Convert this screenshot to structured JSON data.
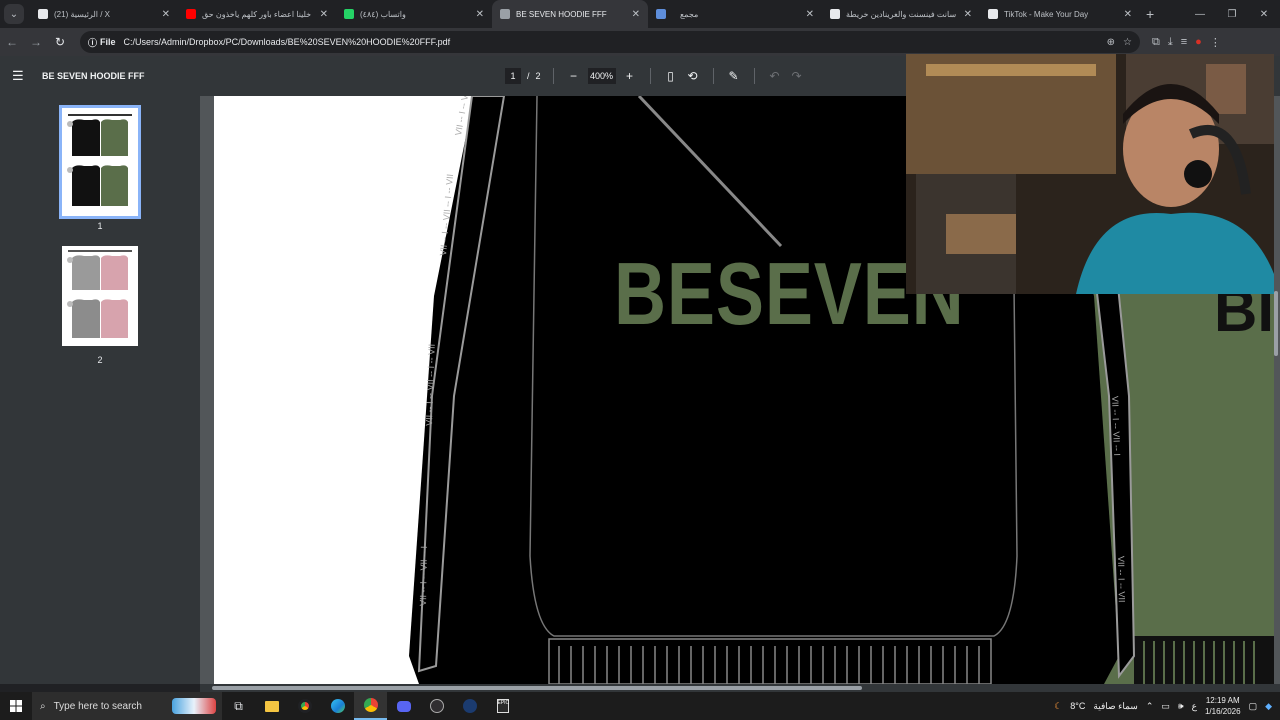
{
  "browser": {
    "tabs": [
      {
        "title": "(21) الرئيسية / X",
        "icon": "x-logo-icon",
        "color": "#e8eaed",
        "active": false,
        "width": 148
      },
      {
        "title": "خلينا اعضاء باور كلهم ياخذون حق",
        "icon": "youtube-icon",
        "color": "#ff0000",
        "active": false,
        "width": 158
      },
      {
        "title": "(٤٨٤) واتساب",
        "icon": "whatsapp-icon",
        "color": "#25d366",
        "active": false,
        "width": 156
      },
      {
        "title": "BE SEVEN HOODIE FFF",
        "icon": "globe-icon",
        "color": "#9aa0a6",
        "active": true,
        "width": 156
      },
      {
        "title": "",
        "icon": "shopify-icon",
        "color": "#5e8edb",
        "active": false,
        "width": 24
      },
      {
        "title": "مجمع",
        "icon": "",
        "color": "#9aa0a6",
        "active": false,
        "width": 150
      },
      {
        "title": "سانت فينسنت والغرينادين خريطة",
        "icon": "google-icon",
        "color": "#e8eaed",
        "active": false,
        "width": 158
      },
      {
        "title": "TikTok - Make Your Day",
        "icon": "tiktok-icon",
        "color": "#e8eaed",
        "active": false,
        "width": 160
      }
    ],
    "omnibox": {
      "scheme_label": "File",
      "url": "C:/Users/Admin/Dropbox/PC/Downloads/BE%20SEVEN%20HOODIE%20FFF.pdf"
    }
  },
  "pdf": {
    "title": "BE SEVEN HOODIE FFF",
    "current_page": "1",
    "page_separator": "/",
    "total_pages": "2",
    "zoom": "400%",
    "thumbnails": [
      {
        "label": "1",
        "selected": true
      },
      {
        "label": "2",
        "selected": false
      }
    ],
    "artwork_text": "BESEVEN"
  },
  "taskbar": {
    "search_placeholder": "Type here to search",
    "weather_temp": "8°C",
    "weather_desc": "سماء صافية",
    "time": "12:19 AM",
    "date": "1/16/2026",
    "lang": "ع"
  },
  "colors": {
    "hoodie_green": "#5a6e4a",
    "hoodie_pink": "#d7a3ad",
    "accent": "#8ab4f8"
  }
}
